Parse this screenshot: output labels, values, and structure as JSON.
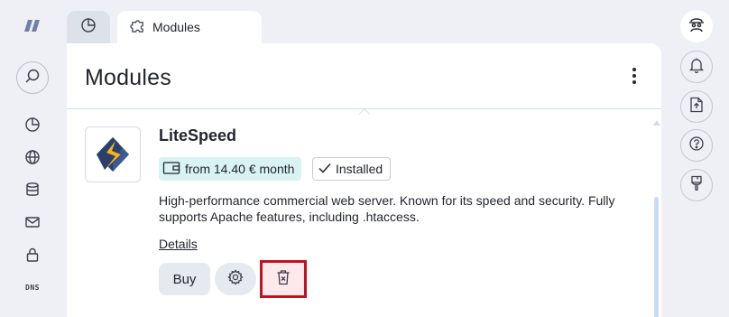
{
  "tabs": {
    "dashboard_icon": "pie-chart-icon",
    "active_tab_label": "Modules"
  },
  "page": {
    "title": "Modules"
  },
  "module": {
    "name": "LiteSpeed",
    "price": "from 14.40 € month",
    "status": "Installed",
    "description": "High-performance commercial web server. Known for its speed and security. Fully supports Apache features, including .htaccess.",
    "details_label": "Details",
    "buy_label": "Buy"
  },
  "left_rail": {
    "dns_label": "DNS",
    "items": [
      "search-icon",
      "pie-chart-icon",
      "globe-icon",
      "database-icon",
      "mail-icon",
      "lock-icon",
      "dns-icon"
    ]
  },
  "right_rail": {
    "items": [
      "avatar-icon",
      "bell-icon",
      "file-upload-icon",
      "help-icon",
      "brush-icon"
    ]
  },
  "colors": {
    "accent_teal": "#d9f3f3",
    "highlight_red": "#c1121f",
    "button_bg": "#e6e9f0"
  }
}
